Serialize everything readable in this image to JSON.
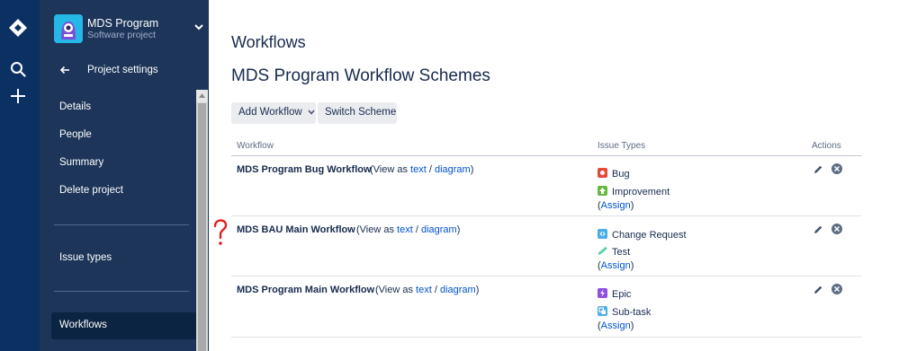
{
  "sidebar": {
    "project_name": "MDS Program",
    "project_type": "Software project",
    "back_label": "Project settings",
    "items": [
      {
        "label": "Details"
      },
      {
        "label": "People"
      },
      {
        "label": "Summary"
      },
      {
        "label": "Delete project"
      },
      {
        "label": "Issue types"
      },
      {
        "label": "Workflows"
      }
    ]
  },
  "main": {
    "title": "Workflows",
    "subtitle": "MDS Program Workflow Schemes",
    "add_workflow_label": "Add Workflow",
    "switch_scheme_label": "Switch Scheme",
    "columns": {
      "workflow": "Workflow",
      "issue_types": "Issue Types",
      "actions": "Actions"
    },
    "view_as": "(View as",
    "text_link": "text",
    "slash": "/",
    "diagram_link": "diagram",
    "close_paren": ")",
    "assign_open": "(",
    "assign_link": "Assign",
    "assign_close": ")",
    "workflows": [
      {
        "name": "MDS Program Bug Workflow",
        "issue_types": [
          {
            "name": "Bug",
            "icon": "bug-icon",
            "color": "#e5493a"
          },
          {
            "name": "Improvement",
            "icon": "improvement-icon",
            "color": "#63ba3c"
          }
        ]
      },
      {
        "name": "MDS BAU Main Workflow",
        "issue_types": [
          {
            "name": "Change Request",
            "icon": "change-request-icon",
            "color": "#4bade8"
          },
          {
            "name": "Test",
            "icon": "test-icon",
            "color": "#4bce97"
          }
        ]
      },
      {
        "name": "MDS Program Main Workflow",
        "issue_types": [
          {
            "name": "Epic",
            "icon": "epic-icon",
            "color": "#904ee2"
          },
          {
            "name": "Sub-task",
            "icon": "subtask-icon",
            "color": "#4bade8"
          }
        ]
      }
    ]
  },
  "annotation": {
    "mark": "?",
    "color": "#e02020"
  }
}
